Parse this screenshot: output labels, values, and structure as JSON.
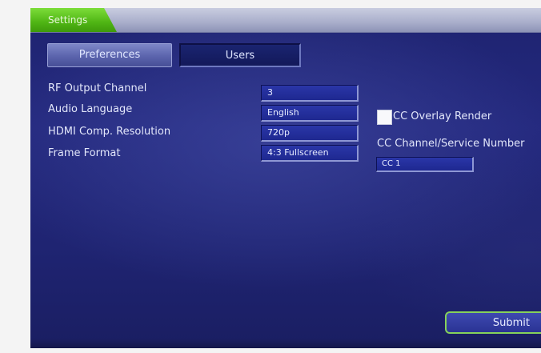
{
  "header": {
    "active_tab_label": "Settings"
  },
  "tabs": [
    {
      "label": "Preferences",
      "active": true
    },
    {
      "label": "Users",
      "active": false
    }
  ],
  "preferences": {
    "fields": [
      {
        "label": "RF Output Channel",
        "value": "3"
      },
      {
        "label": "Audio Language",
        "value": "English"
      },
      {
        "label": "HDMI Comp. Resolution",
        "value": "720p"
      },
      {
        "label": "Frame Format",
        "value": "4:3 Fullscreen"
      }
    ],
    "cc_overlay": {
      "label": "CC Overlay Render",
      "checked": false
    },
    "cc_channel": {
      "label": "CC Channel/Service Number",
      "value": "CC 1"
    }
  },
  "actions": {
    "submit_label": "Submit"
  },
  "colors": {
    "accent_green": "#4fb514",
    "background_blue": "#22277a",
    "field_blue": "#2a36a8"
  }
}
